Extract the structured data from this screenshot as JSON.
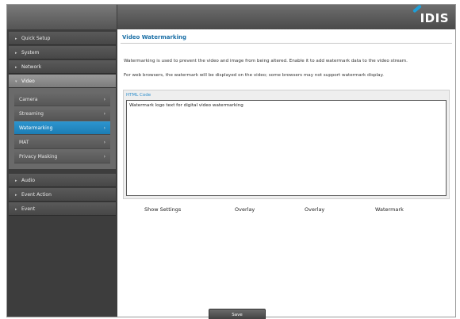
{
  "header": {
    "logo": "IDIS"
  },
  "sidebar": {
    "items_top": [
      {
        "label": "Quick Setup"
      },
      {
        "label": "System"
      },
      {
        "label": "Network"
      },
      {
        "label": "Video"
      }
    ],
    "submenu": [
      {
        "label": "Camera"
      },
      {
        "label": "Streaming"
      },
      {
        "label": "Watermarking"
      },
      {
        "label": "MAT"
      },
      {
        "label": "Privacy Masking"
      }
    ],
    "items_bottom": [
      {
        "label": "Audio"
      },
      {
        "label": "Event Action"
      },
      {
        "label": "Event"
      }
    ]
  },
  "main": {
    "title": "Video Watermarking",
    "desc1": "Watermarking is used to prevent the video and image from being altered. Enable it to add watermark data to the video stream.",
    "desc2": "For web browsers, the watermark will be displayed on the video; some browsers may not support watermark display.",
    "html_code_label": "HTML Code",
    "html_code_value": "Watermark logo text for digital video watermarking",
    "options": [
      {
        "label": "Show Settings"
      },
      {
        "label": "Overlay"
      },
      {
        "label": "Overlay"
      },
      {
        "label": "Watermark"
      }
    ],
    "save_label": "Save"
  }
}
